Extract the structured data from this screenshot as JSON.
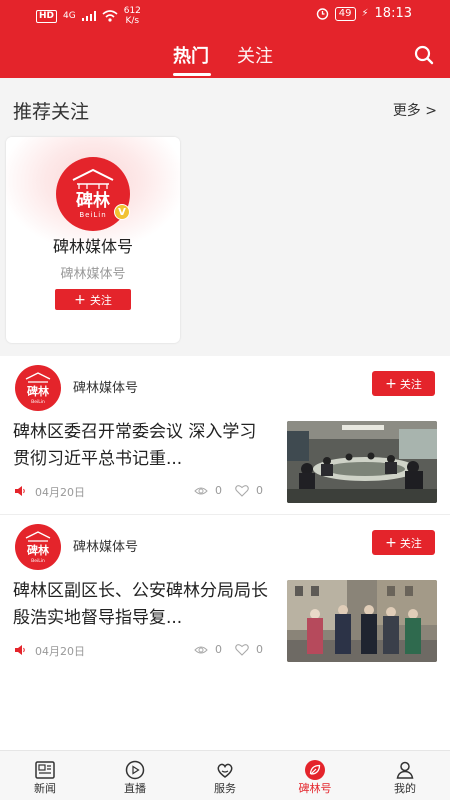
{
  "status_bar": {
    "network_badge": "HD",
    "signal": "4G",
    "speed_value": "612",
    "speed_unit": "K/s",
    "battery": "49",
    "time": "18:13"
  },
  "header": {
    "tabs": [
      {
        "label": "热门",
        "active": true
      },
      {
        "label": "关注",
        "active": false
      }
    ],
    "search_icon": "search-icon"
  },
  "recommend": {
    "title": "推荐关注",
    "more_label": "更多 >",
    "cards": [
      {
        "logo_text": "碑林",
        "logo_sub": "BeiLin",
        "verified": "V",
        "name": "碑林媒体号",
        "subtitle": "碑林媒体号",
        "follow_label": "关注"
      }
    ]
  },
  "feed": {
    "posts": [
      {
        "source": "碑林媒体号",
        "follow_label": "关注",
        "title": "碑林区委召开常委会议 深入学习贯彻习近平总书记重...",
        "date": "04月20日",
        "views": "0",
        "likes": "0"
      },
      {
        "source": "碑林媒体号",
        "follow_label": "关注",
        "title": "碑林区副区长、公安碑林分局局长殷浩实地督导指导复...",
        "date": "04月20日",
        "views": "0",
        "likes": "0"
      }
    ]
  },
  "bottom_nav": {
    "items": [
      {
        "label": "新闻",
        "icon": "news-icon",
        "active": false
      },
      {
        "label": "直播",
        "icon": "live-play-icon",
        "active": false
      },
      {
        "label": "服务",
        "icon": "service-icon",
        "active": false
      },
      {
        "label": "碑林号",
        "icon": "beilin-leaf-icon",
        "active": true
      },
      {
        "label": "我的",
        "icon": "profile-icon",
        "active": false
      }
    ]
  },
  "colors": {
    "brand_red": "#e4242b",
    "muted_text": "#999999"
  }
}
